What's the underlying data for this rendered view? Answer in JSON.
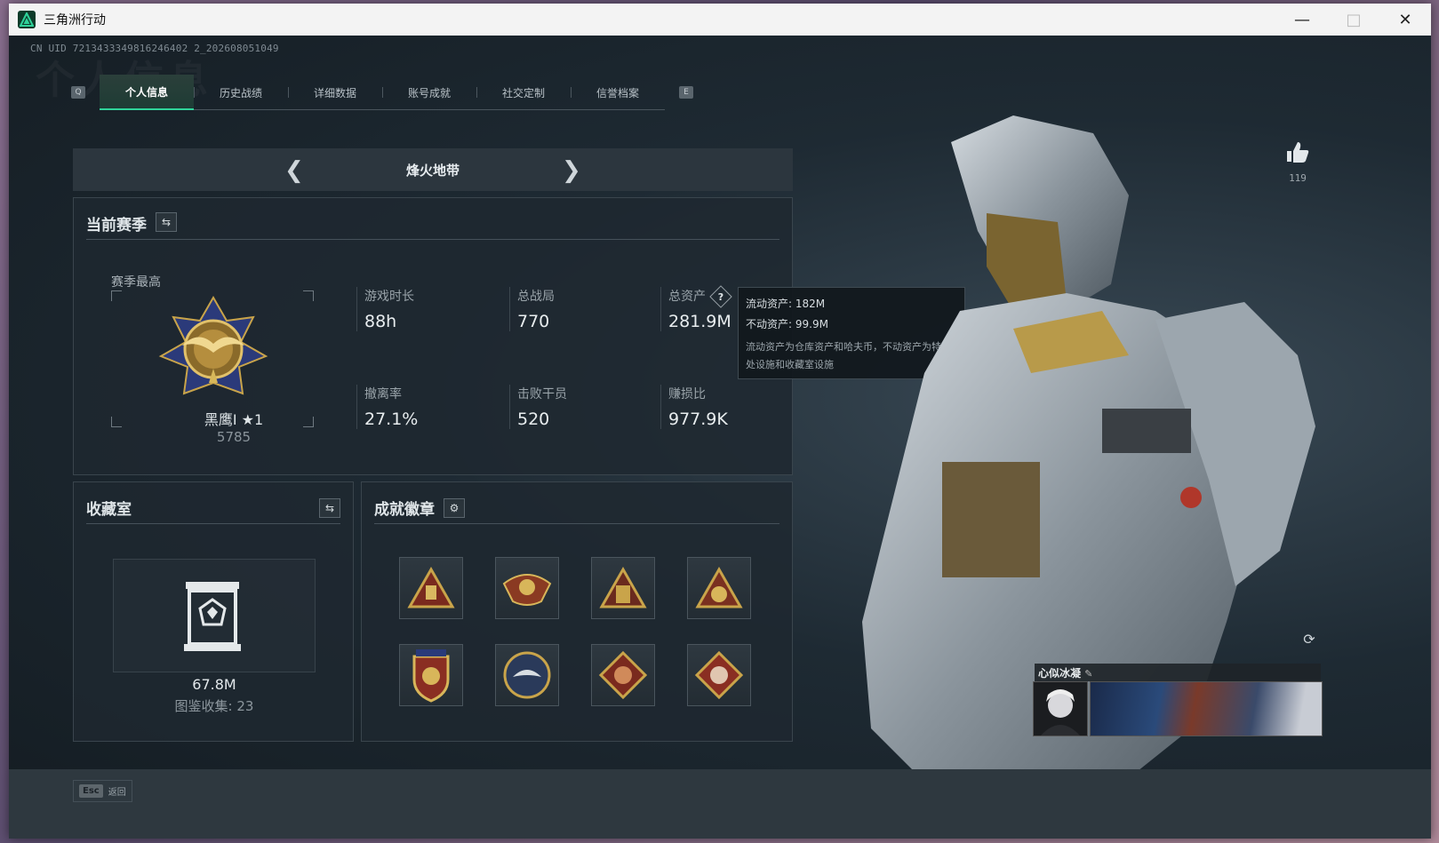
{
  "window": {
    "title": "三角洲行动"
  },
  "uid": "CN UID 7213433349816246402 2_202608051049",
  "watermark": "个人信息",
  "tabs": {
    "left_key": "Q",
    "right_key": "E",
    "items": [
      "个人信息",
      "历史战绩",
      "详细数据",
      "账号成就",
      "社交定制",
      "信誉档案"
    ],
    "active_index": 0
  },
  "mode": {
    "title": "烽火地带"
  },
  "season": {
    "title": "当前赛季",
    "best_label": "赛季最高",
    "rank_name": "黑鹰I ★1",
    "rank_score": "5785",
    "stats": [
      {
        "label": "游戏时长",
        "value": "88h"
      },
      {
        "label": "总战局",
        "value": "770"
      },
      {
        "label": "总资产",
        "value": "281.9M"
      },
      {
        "label": "撤离率",
        "value": "27.1%"
      },
      {
        "label": "击败干员",
        "value": "520"
      },
      {
        "label": "赚损比",
        "value": "977.9K"
      }
    ]
  },
  "tooltip": {
    "liquid": "流动资产: 182M",
    "fixed": "不动资产: 99.9M",
    "desc": "流动资产为仓库资产和哈夫币，不动资产为特勤处设施和收藏室设施"
  },
  "collection": {
    "title": "收藏室",
    "value": "67.8M",
    "count": "图鉴收集: 23"
  },
  "badges": {
    "title": "成就徽章",
    "items": [
      "triangle-badge",
      "winged-emblem-badge",
      "tower-badge",
      "tiger-badge",
      "shield-badge",
      "eagle-badge",
      "dragon-badge",
      "wolf-badge"
    ]
  },
  "likes": {
    "count": "119"
  },
  "profile_card": {
    "name": "心似冰凝"
  },
  "footer": {
    "esc_key": "Esc",
    "esc_label": "返回"
  },
  "colors": {
    "accent": "#2fd39a",
    "gold": "#c9a44a",
    "badge_red": "#8a2e22"
  }
}
